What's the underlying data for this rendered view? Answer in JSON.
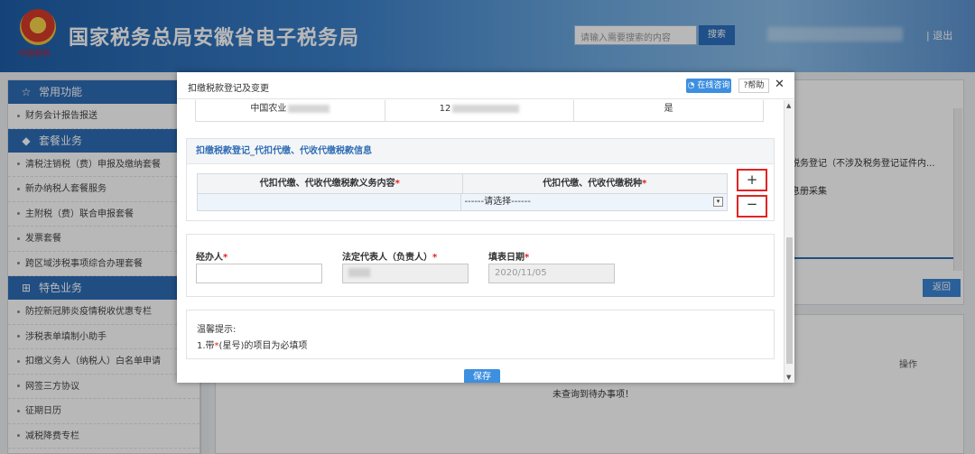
{
  "header": {
    "site_title": "国家税务总局安徽省电子税务局",
    "emblem_subtitle": "中国税务",
    "search_placeholder": "请输入需要搜索的内容",
    "search_button": "搜索",
    "logout": "| 退出"
  },
  "sidebar": {
    "groups": [
      {
        "title": "常用功能",
        "icon": "star-icon",
        "items": [
          "财务会计报告报送"
        ]
      },
      {
        "title": "套餐业务",
        "icon": "package-icon",
        "items": [
          "清税注销税（费）申报及缴纳套餐",
          "新办纳税人套餐服务",
          "主附税（费）联合申报套餐",
          "发票套餐",
          "跨区域涉税事项综合办理套餐"
        ]
      },
      {
        "title": "特色业务",
        "icon": "grid-icon",
        "items": [
          "防控新冠肺炎疫情税收优惠专栏",
          "涉税表单填制小助手",
          "扣缴义务人（纳税人）白名单申请",
          "网签三方协议",
          "征期日历",
          "减税降费专栏"
        ]
      }
    ]
  },
  "background": {
    "text1": "税务登记（不涉及税务登记证件内...",
    "text2": "息册采集",
    "return_button": "返回",
    "op_column": "操作",
    "empty_message": "未查询到待办事项！"
  },
  "modal": {
    "title": "扣缴税款登记及变更",
    "consult_button": "在线咨询",
    "help_button": "帮助",
    "close": "✕",
    "top_row": {
      "col1": "中国农业",
      "col2": "12",
      "col3": "是"
    },
    "section_title": "扣缴税款登记_代扣代缴、代收代缴税款信息",
    "table": {
      "col1_header": "代扣代缴、代收代缴税款义务内容",
      "col2_header": "代扣代缴、代收代缴税种",
      "required_mark": "*",
      "select_value": "------请选择------",
      "add_button": "+",
      "remove_button": "−"
    },
    "form": {
      "agent_label": "经办人",
      "legal_rep_label": "法定代表人（负责人）",
      "date_label": "填表日期",
      "required_mark": "*",
      "date_value": "2020/11/05"
    },
    "tips": {
      "title": "温馨提示:",
      "line1_prefix": "1.带",
      "line1_star": "*",
      "line1_suffix": "(星号)的项目为必填项"
    },
    "save_button": "保存"
  }
}
